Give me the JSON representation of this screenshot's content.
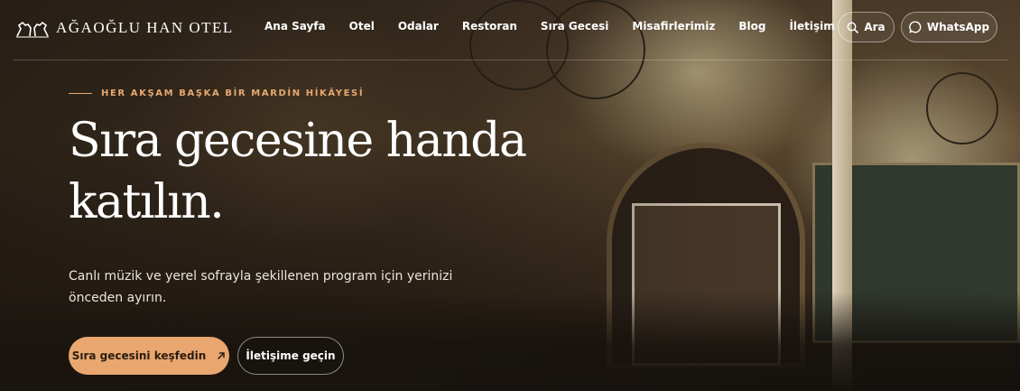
{
  "brand": {
    "logo_text": "AĞAOĞLU HAN OTEL",
    "logo_icon": "horse-pair-icon"
  },
  "nav": {
    "items": [
      {
        "label": "Ana Sayfa"
      },
      {
        "label": "Otel"
      },
      {
        "label": "Odalar"
      },
      {
        "label": "Restoran"
      },
      {
        "label": "Sıra Gecesi"
      },
      {
        "label": "Misafirlerimiz"
      },
      {
        "label": "Blog"
      },
      {
        "label": "İletişim"
      }
    ],
    "search_label": "Ara",
    "search_icon": "search-icon",
    "whatsapp_label": "WhatsApp",
    "whatsapp_icon": "chat-bubble-icon"
  },
  "hero": {
    "eyebrow": "HER AKŞAM BAŞKA BİR MARDİN HİKÂYESİ",
    "title_line1": "Sıra gecesine handa",
    "title_line2": "katılın.",
    "subtitle": "Canlı müzik ve yerel sofrayla şekillenen program için yerinizi önceden ayırın.",
    "primary_cta": "Sıra gecesini keşfedin",
    "primary_cta_icon": "arrow-up-right-icon",
    "secondary_cta": "İletişime geçin"
  },
  "colors": {
    "accent": "#e9a66e",
    "eyebrow": "#e8a870"
  }
}
